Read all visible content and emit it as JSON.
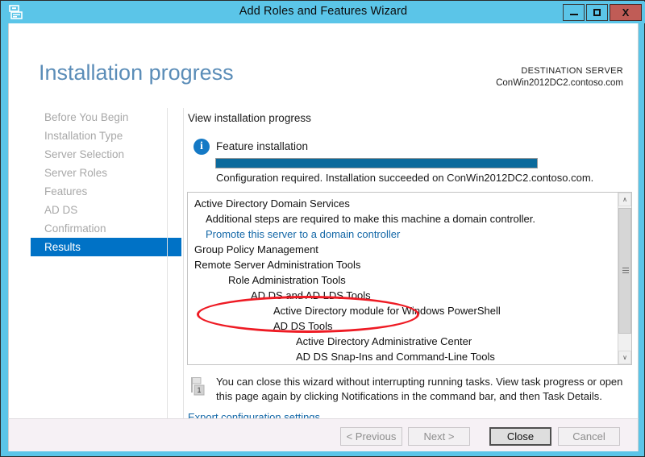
{
  "window": {
    "title": "Add Roles and Features Wizard",
    "icon": "server-wizard-icon",
    "minimize_label": "Minimize",
    "maximize_label": "Maximize",
    "close_label": "X"
  },
  "header": {
    "page_title": "Installation progress",
    "destination_label": "DESTINATION SERVER",
    "destination_server": "ConWin2012DC2.contoso.com"
  },
  "sidebar": {
    "items": [
      {
        "label": "Before You Begin",
        "active": false
      },
      {
        "label": "Installation Type",
        "active": false
      },
      {
        "label": "Server Selection",
        "active": false
      },
      {
        "label": "Server Roles",
        "active": false
      },
      {
        "label": "Features",
        "active": false
      },
      {
        "label": "AD DS",
        "active": false
      },
      {
        "label": "Confirmation",
        "active": false
      },
      {
        "label": "Results",
        "active": true
      }
    ]
  },
  "main": {
    "heading": "View installation progress",
    "feature_label": "Feature installation",
    "info_glyph": "i",
    "progress_percent": 100,
    "progress_status": "Configuration required. Installation succeeded on ConWin2012DC2.contoso.com.",
    "results": [
      {
        "text": "Active Directory Domain Services",
        "level": 0,
        "kind": "text"
      },
      {
        "text": "Additional steps are required to make this machine a domain controller.",
        "level": 1,
        "kind": "text"
      },
      {
        "text": "Promote this server to a domain controller",
        "level": 1,
        "kind": "link"
      },
      {
        "text": "Group Policy Management",
        "level": 0,
        "kind": "text"
      },
      {
        "text": "Remote Server Administration Tools",
        "level": 0,
        "kind": "text"
      },
      {
        "text": "Role Administration Tools",
        "level": 2,
        "kind": "text"
      },
      {
        "text": "AD DS and AD LDS Tools",
        "level": 3,
        "kind": "text"
      },
      {
        "text": "Active Directory module for Windows PowerShell",
        "level": 4,
        "kind": "text"
      },
      {
        "text": "AD DS Tools",
        "level": 4,
        "kind": "text"
      },
      {
        "text": "Active Directory Administrative Center",
        "level": 5,
        "kind": "text"
      },
      {
        "text": "AD DS Snap-Ins and Command-Line Tools",
        "level": 5,
        "kind": "text"
      }
    ],
    "scrollbar": {
      "up_arrow": "∧",
      "down_arrow": "∨"
    },
    "notice_badge": "1",
    "notice_text": "You can close this wizard without interrupting running tasks. View task progress or open this page again by clicking Notifications in the command bar, and then Task Details.",
    "export_link": "Export configuration settings"
  },
  "annotation": {
    "shape": "red-ellipse",
    "color": "#ee1b24",
    "targets": "Promote this server to a domain controller"
  },
  "footer": {
    "previous": "< Previous",
    "next": "Next >",
    "close": "Close",
    "cancel": "Cancel"
  },
  "colors": {
    "window_frame": "#5bc5e8",
    "accent_blue": "#0072c6",
    "progress_fill": "#0b6a9c",
    "link": "#1367a7",
    "title_text": "#5b8db8",
    "close_button": "#c05c56"
  }
}
